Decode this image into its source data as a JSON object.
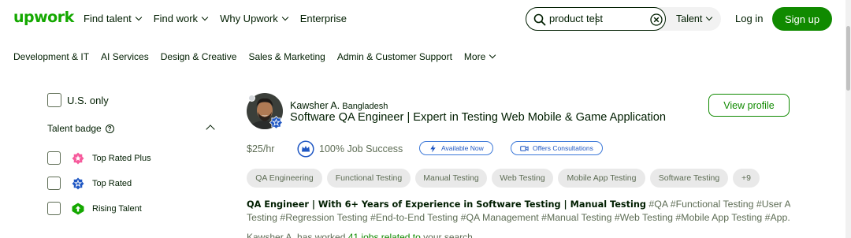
{
  "header": {
    "logo": "upwork",
    "nav": [
      {
        "label": "Find talent",
        "dropdown": true
      },
      {
        "label": "Find work",
        "dropdown": true
      },
      {
        "label": "Why Upwork",
        "dropdown": true
      },
      {
        "label": "Enterprise",
        "dropdown": false
      }
    ],
    "search": {
      "value": "product test",
      "scope": "Talent"
    },
    "login": "Log in",
    "signup": "Sign up"
  },
  "categories": [
    "Development & IT",
    "AI Services",
    "Design & Creative",
    "Sales & Marketing",
    "Admin & Customer Support",
    "More"
  ],
  "filters": {
    "us_only": "U.S. only",
    "talent_badge": "Talent badge",
    "badges": [
      {
        "label": "Top Rated Plus",
        "color": "#f65a9c",
        "icon": "star-plus-icon"
      },
      {
        "label": "Top Rated",
        "color": "#1f57c3",
        "icon": "star-icon"
      },
      {
        "label": "Rising Talent",
        "color": "#14a800",
        "icon": "arrow-up-icon"
      }
    ]
  },
  "profile": {
    "name": "Kawsher A.",
    "country": "Bangladesh",
    "headline": "Software QA Engineer | Expert in Testing Web Mobile & Game Application",
    "view_profile": "View profile",
    "rate": "$25/hr",
    "job_success": "100% Job Success",
    "available": "Available Now",
    "consultations": "Offers Consultations",
    "skills": [
      "QA Engineering",
      "Functional Testing",
      "Manual Testing",
      "Web Testing",
      "Mobile App Testing",
      "Software Testing",
      "+9"
    ],
    "desc_bold": "QA Engineer | With 6+ Years of Experience in Software Testing | Manual Testing",
    "desc_rest": " #QA #Functional Testing #User Acceptance",
    "desc_line2": "Testing #Regression Testing #End-to-End Testing #QA Management #Manual Testing #Web Testing #Mobile App Testing #App...",
    "next_line_start": "Kawsher A. has worked",
    "next_line_green": "41 jobs related to",
    "next_line_end": "your search"
  },
  "colors": {
    "brand": "#14a800",
    "button": "#108a00",
    "link_blue": "#1f57c3"
  }
}
